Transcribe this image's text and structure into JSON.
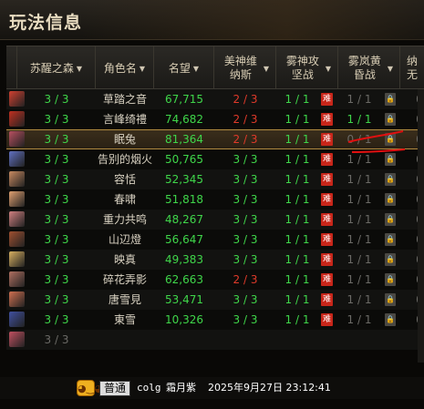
{
  "title": "玩法信息",
  "columns": [
    {
      "label": "苏醒之森",
      "sortable": true
    },
    {
      "label": "角色名",
      "sortable": true
    },
    {
      "label": "名望",
      "sortable": true
    },
    {
      "label": "美神维纳斯",
      "sortable": true
    },
    {
      "label": "雾神攻坚战",
      "sortable": true
    },
    {
      "label": "雾岚黄昏战",
      "sortable": true
    },
    {
      "label": "纳无",
      "sortable": false
    }
  ],
  "hard_label": "难",
  "rows": [
    {
      "forest": "3 / 3",
      "name": "草踏之音",
      "fame": "67,715",
      "venus": "2 / 3",
      "venus_color": "red",
      "mist": "1 / 1",
      "dusk": "1 / 1",
      "dusk_color": "gray",
      "extra": "0"
    },
    {
      "forest": "3 / 3",
      "name": "言峰绮禮",
      "fame": "74,682",
      "venus": "2 / 3",
      "venus_color": "red",
      "mist": "1 / 1",
      "dusk": "1 / 1",
      "dusk_color": "green",
      "extra": "0"
    },
    {
      "forest": "3 / 3",
      "name": "眠兔",
      "fame": "81,364",
      "venus": "2 / 3",
      "venus_color": "red",
      "mist": "1 / 1",
      "dusk": "0 / 1",
      "dusk_color": "gray",
      "extra": "0",
      "selected": true
    },
    {
      "forest": "3 / 3",
      "name": "告别的烟火",
      "fame": "50,765",
      "venus": "3 / 3",
      "venus_color": "green",
      "mist": "1 / 1",
      "dusk": "1 / 1",
      "dusk_color": "gray",
      "extra": "0"
    },
    {
      "forest": "3 / 3",
      "name": "容恬",
      "fame": "52,345",
      "venus": "3 / 3",
      "venus_color": "green",
      "mist": "1 / 1",
      "dusk": "1 / 1",
      "dusk_color": "gray",
      "extra": "0"
    },
    {
      "forest": "3 / 3",
      "name": "春啸",
      "fame": "51,818",
      "venus": "3 / 3",
      "venus_color": "green",
      "mist": "1 / 1",
      "dusk": "1 / 1",
      "dusk_color": "gray",
      "extra": "0"
    },
    {
      "forest": "3 / 3",
      "name": "重力共鸣",
      "fame": "48,267",
      "venus": "3 / 3",
      "venus_color": "green",
      "mist": "1 / 1",
      "dusk": "1 / 1",
      "dusk_color": "gray",
      "extra": "0"
    },
    {
      "forest": "3 / 3",
      "name": "山辺燈",
      "fame": "56,647",
      "venus": "3 / 3",
      "venus_color": "green",
      "mist": "1 / 1",
      "dusk": "1 / 1",
      "dusk_color": "gray",
      "extra": "0"
    },
    {
      "forest": "3 / 3",
      "name": "映真",
      "fame": "49,383",
      "venus": "3 / 3",
      "venus_color": "green",
      "mist": "1 / 1",
      "dusk": "1 / 1",
      "dusk_color": "gray",
      "extra": "0"
    },
    {
      "forest": "3 / 3",
      "name": "碎花弄影",
      "fame": "62,663",
      "venus": "2 / 3",
      "venus_color": "red",
      "mist": "1 / 1",
      "dusk": "1 / 1",
      "dusk_color": "gray",
      "extra": "0"
    },
    {
      "forest": "3 / 3",
      "name": "唐雪見",
      "fame": "53,471",
      "venus": "3 / 3",
      "venus_color": "green",
      "mist": "1 / 1",
      "dusk": "1 / 1",
      "dusk_color": "gray",
      "extra": "0"
    },
    {
      "forest": "3 / 3",
      "name": "東雪",
      "fame": "10,326",
      "venus": "3 / 3",
      "venus_color": "green",
      "mist": "1 / 1",
      "dusk": "1 / 1",
      "dusk_color": "gray",
      "extra": "0"
    },
    {
      "forest": "3 / 3",
      "name": "",
      "fame": "",
      "venus": "",
      "venus_color": "green",
      "mist": "",
      "dusk": "",
      "dusk_color": "gray",
      "extra": ""
    }
  ],
  "chat": {
    "channel": "普通",
    "sender": "colg",
    "message": "霜月紫",
    "timestamp": "2025年9月27日 23:12:41"
  },
  "colors": {
    "accent_green": "#3fd64a",
    "accent_red": "#e03a2a",
    "hard_badge": "#c8261a",
    "annotation": "#e01010"
  }
}
